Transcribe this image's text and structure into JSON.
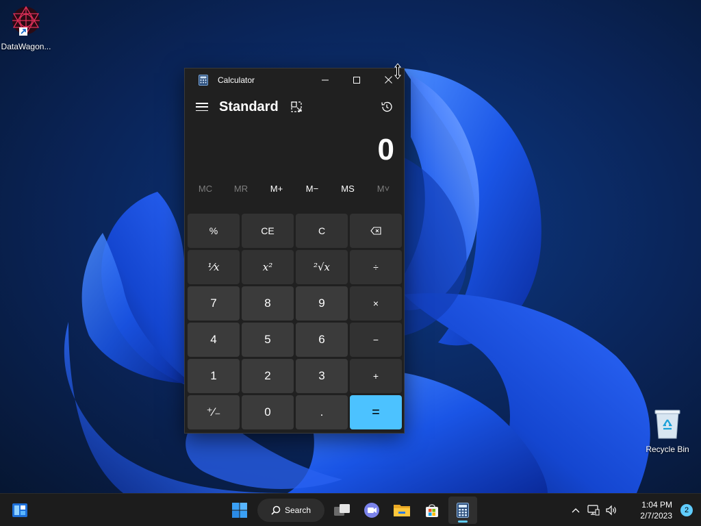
{
  "desktop": {
    "icons": [
      {
        "label": "DataWagon..."
      },
      {
        "label": "Recycle Bin"
      }
    ]
  },
  "calculator": {
    "window_title": "Calculator",
    "mode": "Standard",
    "display_value": "0",
    "memory_buttons": [
      {
        "label": "MC",
        "enabled": false
      },
      {
        "label": "MR",
        "enabled": false
      },
      {
        "label": "M+",
        "enabled": true
      },
      {
        "label": "M−",
        "enabled": true
      },
      {
        "label": "MS",
        "enabled": true
      },
      {
        "label": "M˅",
        "enabled": false
      }
    ],
    "keys": {
      "percent": "%",
      "ce": "CE",
      "c": "C",
      "backspace": "⌫",
      "reciprocal": "¹⁄x",
      "square": "x²",
      "sqrt": "²√x",
      "divide": "÷",
      "seven": "7",
      "eight": "8",
      "nine": "9",
      "multiply": "×",
      "four": "4",
      "five": "5",
      "six": "6",
      "minus": "−",
      "one": "1",
      "two": "2",
      "three": "3",
      "plus": "+",
      "negate": "⁺⁄₋",
      "zero": "0",
      "decimal": ".",
      "equals": "="
    }
  },
  "taskbar": {
    "search_label": "Search",
    "time": "1:04 PM",
    "date": "2/7/2023",
    "notification_count": "2"
  },
  "colors": {
    "accent": "#4cc2ff",
    "window_bg": "#202020",
    "taskbar_bg": "#1c1c1c"
  }
}
